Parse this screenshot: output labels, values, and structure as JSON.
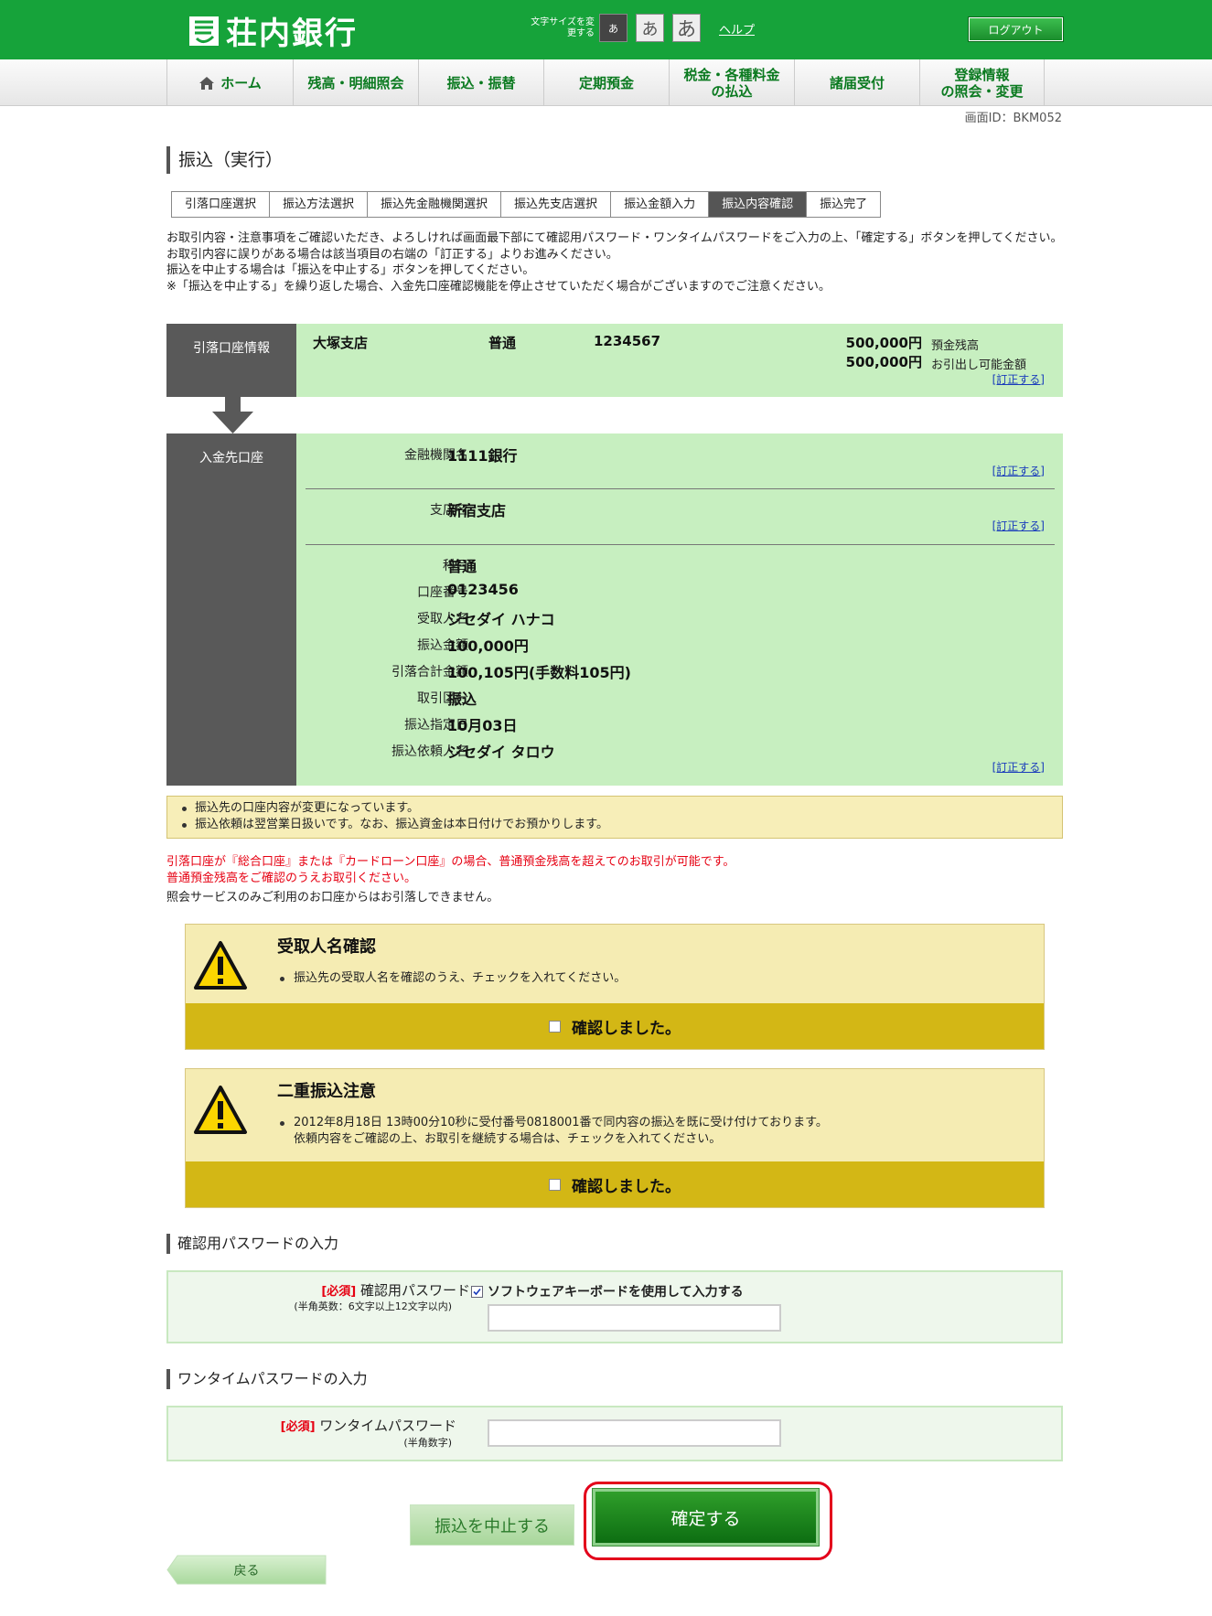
{
  "header": {
    "bank_name": "荘内銀行",
    "font_size_label": "文字サイズを変更する",
    "font_sizes": [
      "あ",
      "あ",
      "あ"
    ],
    "help_label": "ヘルプ",
    "logout_label": "ログアウト"
  },
  "nav": {
    "items": [
      {
        "label": "ホーム"
      },
      {
        "label": "残高・明細照会"
      },
      {
        "label": "振込・振替"
      },
      {
        "label": "定期預金"
      },
      {
        "label": "税金・各種料金\nの払込"
      },
      {
        "label": "諸届受付"
      },
      {
        "label": "登録情報\nの照会・変更"
      }
    ]
  },
  "screen_id": "画面ID：BKM052",
  "page_title": "振込（実行）",
  "steps": [
    {
      "label": "引落口座選択",
      "active": false
    },
    {
      "label": "振込方法選択",
      "active": false
    },
    {
      "label": "振込先金融機関選択",
      "active": false
    },
    {
      "label": "振込先支店選択",
      "active": false
    },
    {
      "label": "振込金額入力",
      "active": false
    },
    {
      "label": "振込内容確認",
      "active": true
    },
    {
      "label": "振込完了",
      "active": false
    }
  ],
  "instructions": [
    "お取引内容・注意事項をご確認いただき、よろしければ画面最下部にて確認用パスワード・ワンタイムパスワードをご入力の上、「確定する」ボタンを押してください。",
    "お取引内容に誤りがある場合は該当項目の右端の「訂正する」よりお進みください。",
    "振込を中止する場合は「振込を中止する」ボタンを押してください。",
    "※「振込を中止する」を繰り返した場合、入金先口座確認機能を停止させていただく場合がございますのでご注意ください。"
  ],
  "from_account": {
    "label": "引落口座情報",
    "branch": "大塚支店",
    "type": "普通",
    "number": "1234567",
    "balance": "500,000円",
    "balance_label": "預金残高",
    "available": "500,000円",
    "available_label": "お引出し可能金額",
    "correct": "[訂正する]"
  },
  "to_account": {
    "label": "入金先口座",
    "bank_label": "金融機関名",
    "bank": "1111銀行",
    "branch_label": "支店名",
    "branch": "新宿支店",
    "correct": "[訂正する]",
    "details": [
      {
        "label": "科目",
        "value": "普通"
      },
      {
        "label": "口座番号",
        "value": "0123456"
      },
      {
        "label": "受取人名",
        "value": "ジセダイ ハナコ"
      },
      {
        "label": "振込金額",
        "value": "100,000円"
      },
      {
        "label": "引落合計金額",
        "value": "100,105円(手数料105円)"
      },
      {
        "label": "取引区分",
        "value": "振込"
      },
      {
        "label": "振込指定日",
        "value": "10月03日"
      },
      {
        "label": "振込依頼人名",
        "value": "ジセダイ タロウ"
      }
    ]
  },
  "notes": [
    "振込先の口座内容が変更になっています。",
    "振込依頼は翌営業日扱いです。なお、振込資金は本日付けでお預かりします。"
  ],
  "red_messages": [
    "引落口座が『総合口座』または『カードローン口座』の場合、普通預金残高を超えてのお取引が可能です。",
    "普通預金残高をご確認のうえお取引ください。"
  ],
  "black_message": "照会サービスのみご利用のお口座からはお引落しできません。",
  "alerts": [
    {
      "title": "受取人名確認",
      "body": [
        "振込先の受取人名を確認のうえ、チェックを入れてください。"
      ],
      "check_label": "確認しました。"
    },
    {
      "title": "二重振込注意",
      "body": [
        "2012年8月18日 13時00分10秒に受付番号0818001番で同内容の振込を既に受け付けております。",
        "依頼内容をご確認の上、お取引を継続する場合は、チェックを入れてください。"
      ],
      "check_label": "確認しました。"
    }
  ],
  "password_section": {
    "title": "確認用パスワードの入力",
    "required": "[必須]",
    "label": "確認用パスワード",
    "hint": "(半角英数：6文字以上12文字以内)",
    "software_keyboard": "ソフトウェアキーボードを使用して入力する",
    "software_keyboard_checked": true,
    "value": ""
  },
  "otp_section": {
    "title": "ワンタイムパスワードの入力",
    "required": "[必須]",
    "label": "ワンタイムパスワード",
    "hint": "(半角数字)",
    "value": ""
  },
  "buttons": {
    "cancel": "振込を中止する",
    "confirm": "確定する",
    "back": "戻る"
  },
  "colors": {
    "brand_green": "#16a33a",
    "info_bg": "#c7efc0",
    "label_bg": "#595959",
    "alert_bar": "#d3b715",
    "highlight_red": "#e3001b"
  }
}
